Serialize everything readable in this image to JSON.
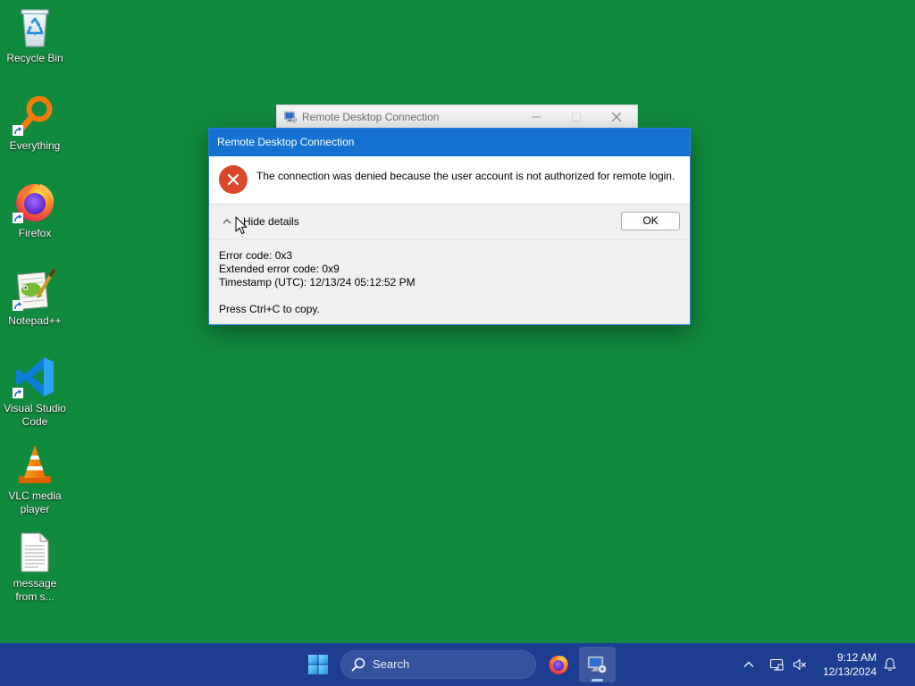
{
  "colors": {
    "desktop": "#108a3d",
    "taskbar": "#1c3d90",
    "dialog_titlebar": "#1672d2",
    "error": "#d9482a"
  },
  "desktop": {
    "icons": [
      {
        "icon": "recycle-bin-icon",
        "label_lines": [
          "Recycle Bin"
        ]
      },
      {
        "icon": "everything-search-icon",
        "label_lines": [
          "Everything"
        ]
      },
      {
        "icon": "firefox-icon",
        "label_lines": [
          "Firefox"
        ]
      },
      {
        "icon": "notepad-plus-plus-icon",
        "label_lines": [
          "Notepad++"
        ]
      },
      {
        "icon": "vscode-icon",
        "label_lines": [
          "Visual Studio",
          "Code"
        ]
      },
      {
        "icon": "vlc-cone-icon",
        "label_lines": [
          "VLC media",
          "player"
        ]
      },
      {
        "icon": "text-document-icon",
        "label_lines": [
          "message",
          "from s..."
        ]
      }
    ]
  },
  "background_window": {
    "title": "Remote Desktop Connection",
    "icon": "remote-desktop-icon"
  },
  "dialog": {
    "title": "Remote Desktop Connection",
    "icon": "error-icon",
    "message": "The connection was denied because the user account is not authorized for remote login.",
    "details_toggle": "Hide details",
    "ok_label": "OK",
    "details": {
      "error_code": "Error code: 0x3",
      "extended_error_code": "Extended error code: 0x9",
      "timestamp": "Timestamp (UTC): 12/13/24 05:12:52 PM",
      "copy_hint": "Press Ctrl+C to copy."
    }
  },
  "taskbar": {
    "start_icon": "windows-start-icon",
    "search_placeholder": "Search",
    "pinned": [
      {
        "icon": "firefox-icon",
        "active": false
      },
      {
        "icon": "remote-desktop-icon",
        "active": true
      }
    ],
    "tray": {
      "icons": [
        "chevron-up-icon",
        "network-icon",
        "speaker-muted-icon",
        "notification-bell-icon"
      ],
      "time": "9:12 AM",
      "date": "12/13/2024"
    }
  }
}
